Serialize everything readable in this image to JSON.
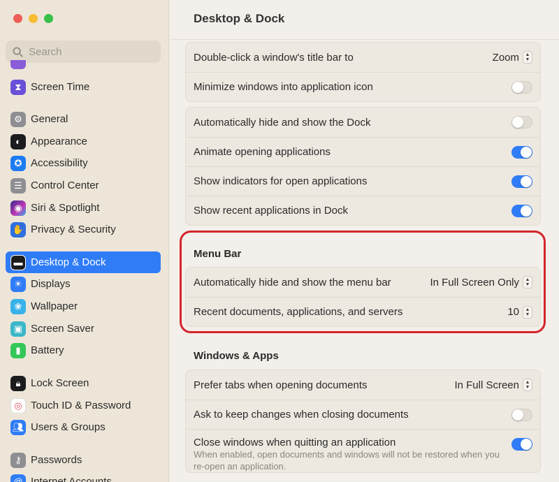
{
  "window": {
    "title": "Desktop & Dock"
  },
  "search": {
    "placeholder": "Search"
  },
  "sidebar": {
    "items": [
      {
        "label": "Screen Time",
        "icon": "hourglass-icon",
        "color": "#6a4fd8"
      },
      {
        "label": "General",
        "icon": "gear-icon",
        "color": "#8e8e93"
      },
      {
        "label": "Appearance",
        "icon": "appearance-icon",
        "color": "#1c1c1e"
      },
      {
        "label": "Accessibility",
        "icon": "accessibility-icon",
        "color": "#1e7cf2"
      },
      {
        "label": "Control Center",
        "icon": "control-center-icon",
        "color": "#8e8e93"
      },
      {
        "label": "Siri & Spotlight",
        "icon": "siri-icon",
        "color": "#b04bd6"
      },
      {
        "label": "Privacy & Security",
        "icon": "hand-icon",
        "color": "#2f6fe0"
      },
      {
        "label": "Desktop & Dock",
        "icon": "dock-icon",
        "color": "#1c1c1e"
      },
      {
        "label": "Displays",
        "icon": "sun-icon",
        "color": "#2f7cf6"
      },
      {
        "label": "Wallpaper",
        "icon": "flower-icon",
        "color": "#38b2e8"
      },
      {
        "label": "Screen Saver",
        "icon": "screensaver-icon",
        "color": "#3cb7c9"
      },
      {
        "label": "Battery",
        "icon": "battery-icon",
        "color": "#35c759"
      },
      {
        "label": "Lock Screen",
        "icon": "lock-icon",
        "color": "#1c1c1e"
      },
      {
        "label": "Touch ID & Password",
        "icon": "fingerprint-icon",
        "color": "#ffffff"
      },
      {
        "label": "Users & Groups",
        "icon": "users-icon",
        "color": "#2f7cf6"
      },
      {
        "label": "Passwords",
        "icon": "key-icon",
        "color": "#8e8e93"
      },
      {
        "label": "Internet Accounts",
        "icon": "at-icon",
        "color": "#2f7cf6"
      }
    ],
    "active": "Desktop & Dock"
  },
  "dock_top": {
    "double_click_label": "Double-click a window's title bar to",
    "double_click_value": "Zoom",
    "minimize_label": "Minimize windows into application icon",
    "minimize_on": false
  },
  "dock": {
    "auto_hide_label": "Automatically hide and show the Dock",
    "auto_hide_on": false,
    "animate_label": "Animate opening applications",
    "animate_on": true,
    "indicators_label": "Show indicators for open applications",
    "indicators_on": true,
    "recent_label": "Show recent applications in Dock",
    "recent_on": true
  },
  "menu_bar": {
    "title": "Menu Bar",
    "auto_hide_label": "Automatically hide and show the menu bar",
    "auto_hide_value": "In Full Screen Only",
    "recent_docs_label": "Recent documents, applications, and servers",
    "recent_docs_value": "10"
  },
  "windows_apps": {
    "title": "Windows & Apps",
    "prefer_tabs_label": "Prefer tabs when opening documents",
    "prefer_tabs_value": "In Full Screen",
    "ask_keep_label": "Ask to keep changes when closing documents",
    "ask_keep_on": false,
    "close_windows_label": "Close windows when quitting an application",
    "close_windows_on": true,
    "close_windows_desc": "When enabled, open documents and windows will not be restored when you re-open an application."
  },
  "colors": {
    "accent": "#2f7cf6",
    "highlight": "#d4252c"
  }
}
